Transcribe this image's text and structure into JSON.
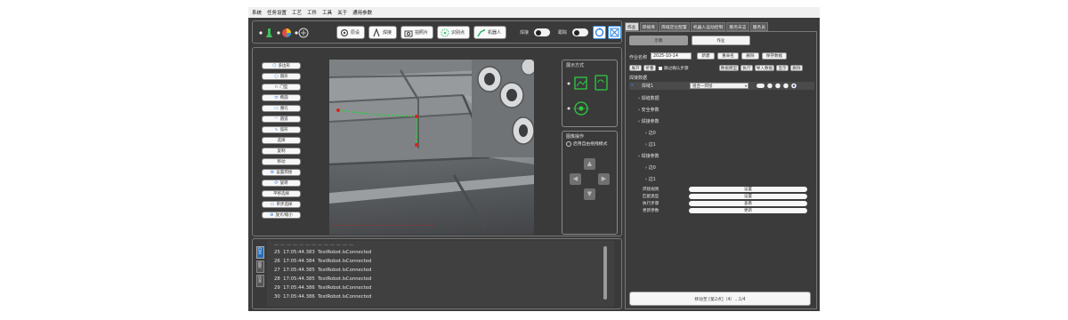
{
  "menu": [
    "系统",
    "任务设置",
    "工艺",
    "工件",
    "工具",
    "关于",
    "通用参数"
  ],
  "toolbar": {
    "buttons": [
      {
        "label": "原设",
        "icon": "gear-icon"
      },
      {
        "label": "焊接",
        "icon": "weld-icon"
      },
      {
        "label": "拍照片",
        "icon": "camera-icon"
      },
      {
        "label": "识别点",
        "icon": "points-icon"
      },
      {
        "label": "机器人",
        "icon": "robot-icon"
      }
    ],
    "toggle1_label": "焊接",
    "toggle2_label": "跟踪"
  },
  "tools": [
    "多边形",
    "圆形",
    "门型",
    "椭圆",
    "腰孔",
    "圆弧",
    "弧形",
    "选择",
    "复制",
    "移动",
    "设置焊接",
    "旋转",
    "平移选择",
    "单步选择",
    "放大/缩小"
  ],
  "view_mode": {
    "title": "展示方式"
  },
  "image_click": {
    "title": "图像操作",
    "option": "启用自由拖拽模式"
  },
  "log": {
    "header_visible": true,
    "tabs": [
      "日志",
      "报警",
      "信息"
    ],
    "lines": [
      {
        "n": "25",
        "t": "17:05:44.383",
        "msg": "TestRobot.IsConnected"
      },
      {
        "n": "26",
        "t": "17:05:44.384",
        "msg": "TestRobot.IsConnected"
      },
      {
        "n": "27",
        "t": "17:05:44.385",
        "msg": "TestRobot.IsConnected"
      },
      {
        "n": "28",
        "t": "17:05:44.385",
        "msg": "TestRobot.IsConnected"
      },
      {
        "n": "29",
        "t": "17:05:44.386",
        "msg": "TestRobot.IsConnected"
      },
      {
        "n": "30",
        "t": "17:05:44.386",
        "msg": "TestRobot.IsConnected"
      }
    ]
  },
  "right_tabs": [
    "作业",
    "焊接库",
    "焊缝定位配置",
    "机器人运动控制",
    "服务日志",
    "服务员"
  ],
  "mode_buttons": {
    "left": "示教",
    "right": "作业"
  },
  "job": {
    "name_label": "作业名称",
    "name_value": "2025-10-14",
    "buttons": [
      "新建",
      "重命名",
      "删除",
      "保存数据"
    ],
    "row2": [
      "展开",
      "折叠"
    ],
    "checkbox_label": "跳过确认步骤",
    "row2_right": [
      "数据模型",
      "执行",
      "导入数据",
      "显示",
      "删除"
    ]
  },
  "tree": {
    "header": "焊接数据",
    "root": "焊缝1",
    "root_select": "组合一焊接",
    "items": [
      "焊缝数据",
      "安全参数",
      "焊接参数",
      "边0",
      "边1",
      "焊接参数",
      "边0",
      "边1"
    ],
    "fields": [
      {
        "label": "焊接规则",
        "value": "设置"
      },
      {
        "label": "匹配类型",
        "value": "设置"
      },
      {
        "label": "执行步骤",
        "value": "查看"
      },
      {
        "label": "更新参数",
        "value": "更新"
      }
    ]
  },
  "status": "移动至 [第2点]（4）...1/4"
}
